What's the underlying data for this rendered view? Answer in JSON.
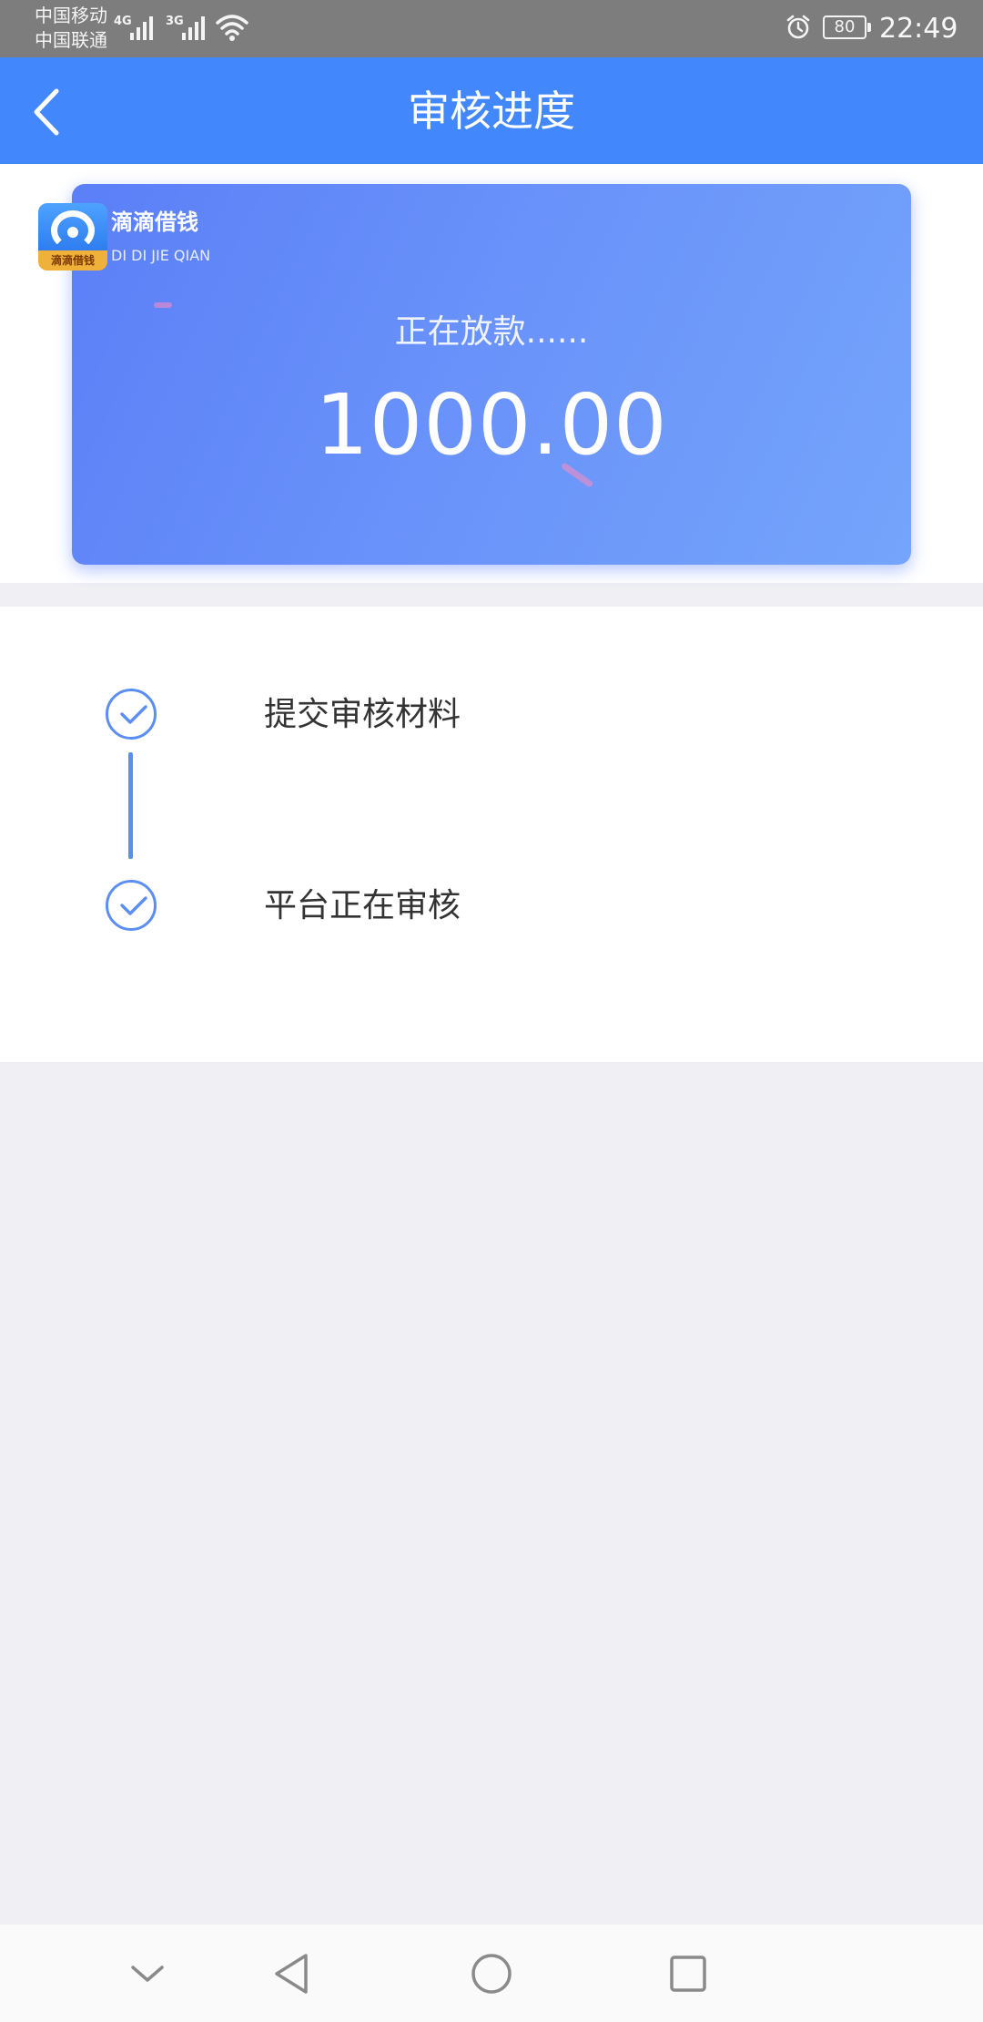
{
  "status_bar": {
    "carrier_1": "中国移动",
    "carrier_2": "中国联通",
    "network_1": "4G",
    "network_2": "3G",
    "battery_level": "80",
    "time": "22:49",
    "icons": [
      "signal-icon",
      "wifi-icon",
      "alarm-icon",
      "battery-icon"
    ]
  },
  "nav": {
    "title": "审核进度",
    "back_icon": "back-arrow-icon"
  },
  "card": {
    "brand_name": "滴滴借钱",
    "brand_sub": "DI DI JIE QIAN",
    "brand_logo_tag": "滴滴借钱",
    "status_text": "正在放款......",
    "amount": "1000.00",
    "gradient_start": "#5b7ff7",
    "gradient_end": "#74a4fb"
  },
  "progress": {
    "steps": [
      {
        "label": "提交审核材料",
        "done": true
      },
      {
        "label": "平台正在审核",
        "done": true
      }
    ],
    "accent_color": "#5b8ef5"
  },
  "system_nav": {
    "buttons": [
      "collapse-icon",
      "back-icon",
      "home-icon",
      "recents-icon"
    ]
  },
  "colors": {
    "header": "#4288fc",
    "page_bg": "#efeff4"
  }
}
